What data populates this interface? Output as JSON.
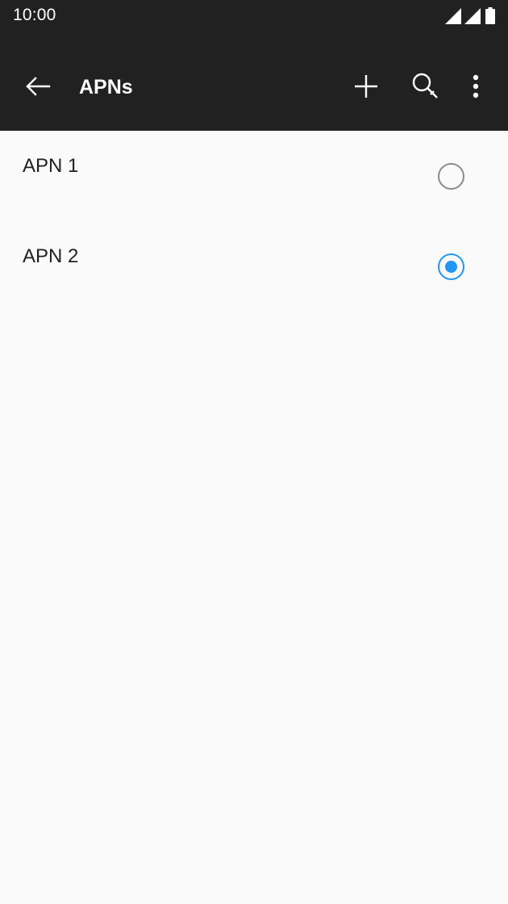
{
  "status_bar": {
    "time": "10:00",
    "icons": [
      "signal-icon",
      "signal-icon",
      "battery-icon"
    ]
  },
  "app_bar": {
    "title": "APNs",
    "back_icon": "arrow-back-icon",
    "add_icon": "plus-icon",
    "search_icon": "search-icon",
    "more_icon": "more-vert-icon"
  },
  "apn_list": {
    "items": [
      {
        "name": "APN 1",
        "selected": false
      },
      {
        "name": "APN 2",
        "selected": true
      }
    ]
  },
  "colors": {
    "app_bar_background": "#212121",
    "accent": "#2196f3",
    "background": "#fafafa",
    "text_primary": "#212121",
    "radio_unchecked": "#8a8a8a"
  }
}
